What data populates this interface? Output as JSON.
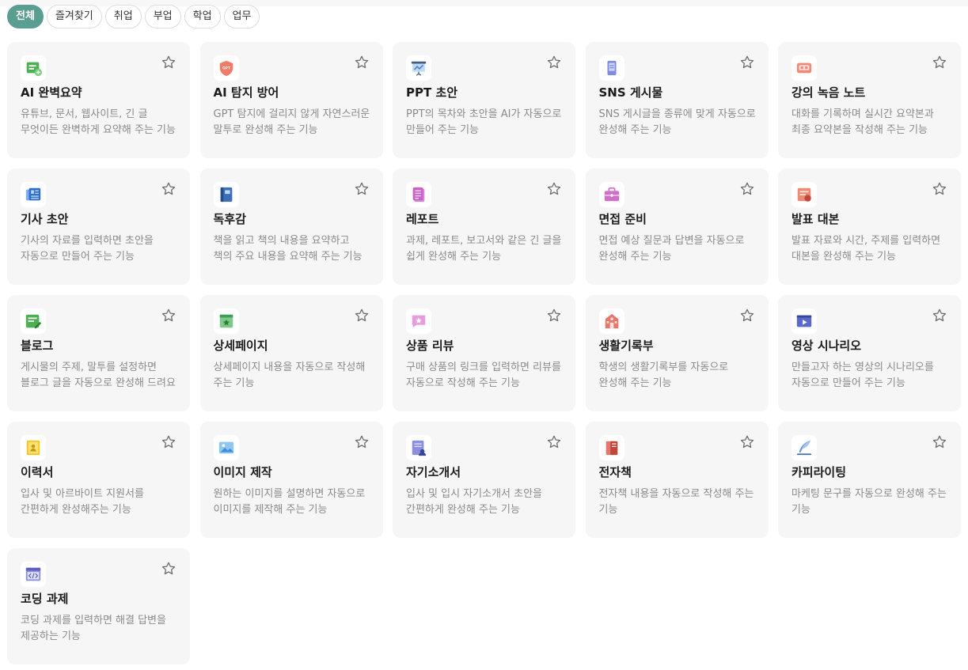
{
  "tabs": [
    {
      "label": "전체",
      "active": true
    },
    {
      "label": "즐겨찾기",
      "active": false
    },
    {
      "label": "취업",
      "active": false
    },
    {
      "label": "부업",
      "active": false
    },
    {
      "label": "학업",
      "active": false
    },
    {
      "label": "업무",
      "active": false
    }
  ],
  "colors": {
    "accent": "#5a9e91",
    "card_bg": "#f6f6f6",
    "desc_text": "#8a8a8a"
  },
  "cards": [
    {
      "title": "AI 완벽요약",
      "desc": "유튜브, 문서, 웹사이트, 긴 글 무엇이든 완벽하게 요약해 주는 기능",
      "icon": "summary-icon",
      "icon_text": ""
    },
    {
      "title": "AI 탐지 방어",
      "desc": "GPT 탐지에 걸리지 않게 자연스러운 말투로 완성해 주는 기능",
      "icon": "gpt-shield-icon",
      "icon_text": "GPT"
    },
    {
      "title": "PPT 초안",
      "desc": "PPT의 목차와 초안을 AI가 자동으로 만들어 주는 기능",
      "icon": "presentation-icon",
      "icon_text": ""
    },
    {
      "title": "SNS 게시물",
      "desc": "SNS 게시글을 종류에 맞게 자동으로 완성해 주는 기능",
      "icon": "phone-post-icon",
      "icon_text": ""
    },
    {
      "title": "강의 녹음 노트",
      "desc": "대화를 기록하며 실시간 요약본과 최종 요약본을 작성해 주는 기능",
      "icon": "recorder-icon",
      "icon_text": ""
    },
    {
      "title": "기사 초안",
      "desc": "기사의 자료를 입력하면 초안을 자동으로 만들어 주는 기능",
      "icon": "newspaper-icon",
      "icon_text": ""
    },
    {
      "title": "독후감",
      "desc": "책을 읽고 책의 내용을 요약하고 책의 주요 내용을 요약해 주는 기능",
      "icon": "book-icon",
      "icon_text": ""
    },
    {
      "title": "레포트",
      "desc": "과제, 레포트, 보고서와 같은 긴 글을 쉽게 완성해 주는 기능",
      "icon": "report-icon",
      "icon_text": ""
    },
    {
      "title": "면접 준비",
      "desc": "면접 예상 질문과 답변을 자동으로 완성해 주는 기능",
      "icon": "briefcase-icon",
      "icon_text": ""
    },
    {
      "title": "발표 대본",
      "desc": "발표 자료와 시간, 주제를 입력하면 대본을 완성해 주는 기능",
      "icon": "script-icon",
      "icon_text": ""
    },
    {
      "title": "블로그",
      "desc": "게시물의 주제, 말투를 설정하면 블로그 글을 자동으로 완성해 드려요",
      "icon": "blog-icon",
      "icon_text": ""
    },
    {
      "title": "상세페이지",
      "desc": "상세페이지 내용을 자동으로 작성해 주는 기능",
      "icon": "detail-page-icon",
      "icon_text": ""
    },
    {
      "title": "상품 리뷰",
      "desc": "구매 상품의 링크를 입력하면 리뷰를 자동으로 작성해 주는 기능",
      "icon": "review-icon",
      "icon_text": ""
    },
    {
      "title": "생활기록부",
      "desc": "학생의 생활기록부를 자동으로 완성해 주는 기능",
      "icon": "school-icon",
      "icon_text": ""
    },
    {
      "title": "영상 시나리오",
      "desc": "만들고자 하는 영상의 시나리오를 자동으로 만들어 주는 기능",
      "icon": "video-icon",
      "icon_text": ""
    },
    {
      "title": "이력서",
      "desc": "입사 및 아르바이트 지원서를 간편하게 완성해주는 기능",
      "icon": "resume-icon",
      "icon_text": ""
    },
    {
      "title": "이미지 제작",
      "desc": "원하는 이미지를 설명하면 자동으로 이미지를 제작해 주는 기능",
      "icon": "image-icon",
      "icon_text": ""
    },
    {
      "title": "자기소개서",
      "desc": "입사 및 입시 자기소개서 초안을 간편하게 완성해 주는 기능",
      "icon": "self-intro-icon",
      "icon_text": ""
    },
    {
      "title": "전자책",
      "desc": "전자책 내용을 자동으로 작성해 주는 기능",
      "icon": "ebook-icon",
      "icon_text": ""
    },
    {
      "title": "카피라이팅",
      "desc": "마케팅 문구를 자동으로 완성해 주는 기능",
      "icon": "quill-icon",
      "icon_text": ""
    },
    {
      "title": "코딩 과제",
      "desc": "코딩 과제를 입력하면 해결 답변을 제공하는 기능",
      "icon": "code-icon",
      "icon_text": ""
    }
  ]
}
